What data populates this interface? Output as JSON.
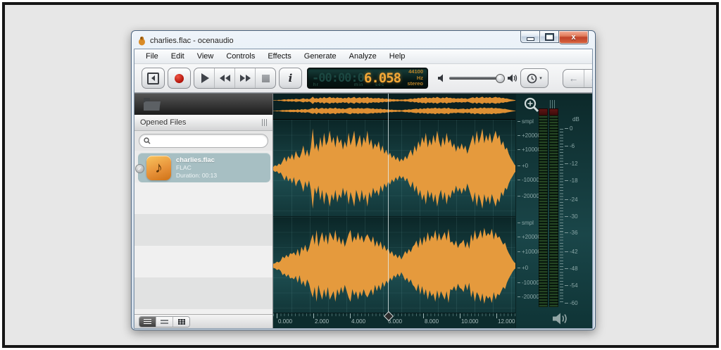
{
  "window": {
    "title": "charlies.flac - ocenaudio",
    "caption": {
      "minimize": "minimize",
      "maximize": "restore",
      "close_glyph": "x"
    }
  },
  "menu": {
    "items": [
      "File",
      "Edit",
      "View",
      "Controls",
      "Effects",
      "Generate",
      "Analyze",
      "Help"
    ]
  },
  "toolbar": {
    "buttons": [
      "skip-to-start",
      "record",
      "play",
      "rewind",
      "fast-forward",
      "stop",
      "info"
    ],
    "time_display": {
      "ghost": "-00:00:0",
      "value": "6.058",
      "sample_rate": "44100 Hz",
      "channel_mode": "stereo",
      "units": [
        "hr",
        "min",
        "sec"
      ]
    },
    "nav": {
      "back": "←",
      "forward": "→",
      "dropdown": "▾"
    }
  },
  "sidebar": {
    "header": "Opened Files",
    "search_value": "",
    "file": {
      "name": "charlies.flac",
      "format": "FLAC",
      "duration": "Duration: 00:13",
      "icon": "music-note",
      "note_glyph": "♪",
      "check_glyph": "✓"
    }
  },
  "wave": {
    "amp_labels": [
      "smpl",
      "+20000",
      "+10000",
      "+0",
      "-10000",
      "-20000"
    ],
    "time_labels": [
      "0.000",
      "2.000",
      "4.000",
      "6.000",
      "8.000",
      "10.000",
      "12.000"
    ],
    "playhead_seconds": 6.058,
    "color_wave": "#e59a3d",
    "color_wave_overview": "#de8f33",
    "samples_l": [
      0.04,
      0.08,
      0.06,
      0.12,
      0.09,
      0.18,
      0.28,
      0.16,
      0.3,
      0.22,
      0.35,
      0.2,
      0.42,
      0.3,
      0.25,
      0.38,
      0.55,
      0.3,
      0.45,
      0.28,
      0.5,
      0.95,
      0.45,
      0.6,
      0.4,
      0.75,
      0.5,
      0.85,
      0.55,
      0.65,
      0.9,
      0.6,
      0.75,
      0.5,
      0.8,
      0.6,
      0.7,
      0.45,
      0.65,
      0.5,
      0.85,
      0.55,
      0.7,
      0.9,
      0.5,
      0.65,
      0.8,
      0.5,
      0.75,
      0.6,
      0.9,
      0.55,
      0.7,
      0.45,
      0.6,
      0.5,
      0.65,
      0.4,
      0.55,
      0.35,
      0.45,
      0.3,
      0.38,
      0.25,
      0.32,
      0.2,
      0.28,
      0.16,
      0.24,
      0.18,
      0.3,
      0.22,
      0.35,
      0.45,
      0.3,
      0.55,
      0.4,
      0.65,
      0.5,
      0.75,
      0.6,
      0.85,
      0.5,
      0.7,
      0.55,
      0.8,
      0.6,
      0.9,
      0.65,
      0.5,
      0.75,
      0.55,
      0.85,
      0.6,
      0.7,
      0.5,
      0.6,
      0.4,
      0.55,
      0.45,
      0.6,
      0.45,
      0.55,
      0.35,
      0.5,
      0.65,
      0.8,
      0.55,
      0.9,
      0.6,
      0.75,
      0.95,
      0.6,
      0.8,
      0.65,
      0.85,
      0.6,
      0.75,
      0.9,
      0.7,
      0.8,
      0.55,
      0.65,
      0.45,
      0.5,
      0.35,
      0.25,
      0.18,
      0.1,
      0.05,
      0.03
    ],
    "samples_r": [
      0.05,
      0.06,
      0.1,
      0.08,
      0.12,
      0.22,
      0.18,
      0.26,
      0.2,
      0.3,
      0.28,
      0.32,
      0.24,
      0.4,
      0.22,
      0.45,
      0.35,
      0.5,
      0.32,
      0.42,
      0.6,
      0.75,
      0.5,
      0.85,
      0.45,
      0.65,
      0.8,
      0.55,
      0.75,
      0.5,
      0.8,
      0.7,
      0.6,
      0.85,
      0.55,
      0.7,
      0.5,
      0.65,
      0.45,
      0.6,
      0.75,
      0.85,
      0.55,
      0.7,
      0.6,
      0.8,
      0.6,
      0.72,
      0.55,
      0.68,
      0.75,
      0.65,
      0.55,
      0.7,
      0.45,
      0.6,
      0.45,
      0.58,
      0.38,
      0.5,
      0.35,
      0.42,
      0.28,
      0.35,
      0.22,
      0.28,
      0.18,
      0.26,
      0.15,
      0.24,
      0.35,
      0.28,
      0.4,
      0.32,
      0.45,
      0.5,
      0.6,
      0.42,
      0.68,
      0.48,
      0.7,
      0.55,
      0.8,
      0.58,
      0.72,
      0.65,
      0.85,
      0.58,
      0.78,
      0.6,
      0.7,
      0.8,
      0.6,
      0.88,
      0.55,
      0.58,
      0.48,
      0.6,
      0.42,
      0.52,
      0.55,
      0.62,
      0.42,
      0.58,
      0.4,
      0.75,
      0.58,
      0.85,
      0.62,
      0.7,
      0.85,
      0.65,
      0.9,
      0.7,
      0.78,
      0.72,
      0.88,
      0.62,
      0.8,
      0.66,
      0.7,
      0.6,
      0.5,
      0.55,
      0.4,
      0.3,
      0.22,
      0.14,
      0.08,
      0.05,
      0.03
    ]
  },
  "meters": {
    "db_unit": "dB",
    "db_labels": [
      "0",
      "-6",
      "-12",
      "-18",
      "-24",
      "-30",
      "-36",
      "-42",
      "-48",
      "-54",
      "-60"
    ]
  }
}
